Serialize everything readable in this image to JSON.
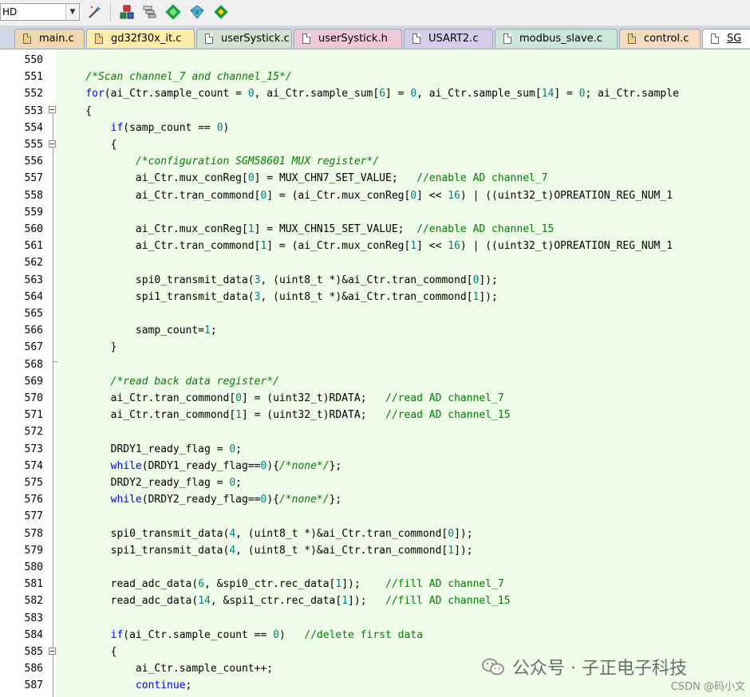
{
  "toolbar": {
    "target_value": "HD",
    "buttons": [
      "magic-wand-icon",
      "manage-components-icon",
      "pack-installer-icon",
      "select-packs-icon",
      "vcs-icon",
      "run-icon"
    ]
  },
  "tabs": [
    {
      "label": "main.c",
      "color": "#f2d8b0",
      "icon": "#f6d07a"
    },
    {
      "label": "gd32f30x_it.c",
      "color": "#ffeeaa",
      "icon": "#f6d07a"
    },
    {
      "label": "userSystick.c",
      "color": "#d6e2d0",
      "icon": "#ffffff"
    },
    {
      "label": "userSystick.h",
      "color": "#f0c8d8",
      "icon": "#ffffff"
    },
    {
      "label": "USART2.c",
      "color": "#d8ccec",
      "icon": "#ffffff"
    },
    {
      "label": "modbus_slave.c",
      "color": "#cde8d6",
      "icon": "#ffffff"
    },
    {
      "label": "control.c",
      "color": "#f6dcc0",
      "icon": "#f6d07a"
    },
    {
      "label": "SG",
      "color": "#ffffff",
      "icon": "#ffffff",
      "active": true
    }
  ],
  "code_lines": [
    {
      "n": "550",
      "segs": []
    },
    {
      "n": "551",
      "segs": [
        [
          "    ",
          ""
        ],
        [
          "/*Scan channel_7 and channel_15*/",
          "cm"
        ]
      ]
    },
    {
      "n": "552",
      "segs": [
        [
          "    ",
          ""
        ],
        [
          "for",
          "kw"
        ],
        [
          "(ai_Ctr.sample_count = ",
          ""
        ],
        [
          "0",
          "num"
        ],
        [
          ", ai_Ctr.sample_sum[",
          ""
        ],
        [
          "6",
          "num"
        ],
        [
          "] = ",
          ""
        ],
        [
          "0",
          "num"
        ],
        [
          ", ai_Ctr.sample_sum[",
          ""
        ],
        [
          "14",
          "num"
        ],
        [
          "] = ",
          ""
        ],
        [
          "0",
          "num"
        ],
        [
          "; ai_Ctr.sample",
          ""
        ]
      ]
    },
    {
      "n": "553",
      "segs": [
        [
          "    {",
          ""
        ]
      ]
    },
    {
      "n": "554",
      "segs": [
        [
          "        ",
          ""
        ],
        [
          "if",
          "kw"
        ],
        [
          "(samp_count == ",
          ""
        ],
        [
          "0",
          "num"
        ],
        [
          ")",
          ""
        ]
      ]
    },
    {
      "n": "555",
      "segs": [
        [
          "        {",
          ""
        ]
      ]
    },
    {
      "n": "556",
      "segs": [
        [
          "            ",
          ""
        ],
        [
          "/*configuration SGM58601 MUX register*/",
          "cm"
        ]
      ]
    },
    {
      "n": "557",
      "segs": [
        [
          "            ai_Ctr.mux_conReg[",
          ""
        ],
        [
          "0",
          "num"
        ],
        [
          "] = MUX_CHN7_SET_VALUE;   ",
          ""
        ],
        [
          "//enable AD channel_7",
          "cm2"
        ]
      ]
    },
    {
      "n": "558",
      "segs": [
        [
          "            ai_Ctr.tran_commond[",
          ""
        ],
        [
          "0",
          "num"
        ],
        [
          "] = (ai_Ctr.mux_conReg[",
          ""
        ],
        [
          "0",
          "num"
        ],
        [
          "] << ",
          ""
        ],
        [
          "16",
          "num"
        ],
        [
          ") | ((uint32_t)OPREATION_REG_NUM_1",
          ""
        ]
      ]
    },
    {
      "n": "559",
      "segs": []
    },
    {
      "n": "560",
      "segs": [
        [
          "            ai_Ctr.mux_conReg[",
          ""
        ],
        [
          "1",
          "num"
        ],
        [
          "] = MUX_CHN15_SET_VALUE;  ",
          ""
        ],
        [
          "//enable AD channel_15",
          "cm2"
        ]
      ]
    },
    {
      "n": "561",
      "segs": [
        [
          "            ai_Ctr.tran_commond[",
          ""
        ],
        [
          "1",
          "num"
        ],
        [
          "] = (ai_Ctr.mux_conReg[",
          ""
        ],
        [
          "1",
          "num"
        ],
        [
          "] << ",
          ""
        ],
        [
          "16",
          "num"
        ],
        [
          ") | ((uint32_t)OPREATION_REG_NUM_1",
          ""
        ]
      ]
    },
    {
      "n": "562",
      "segs": []
    },
    {
      "n": "563",
      "segs": [
        [
          "            spi0_transmit_data(",
          ""
        ],
        [
          "3",
          "num"
        ],
        [
          ", (uint8_t *)&ai_Ctr.tran_commond[",
          ""
        ],
        [
          "0",
          "num"
        ],
        [
          "]);",
          ""
        ]
      ]
    },
    {
      "n": "564",
      "segs": [
        [
          "            spi1_transmit_data(",
          ""
        ],
        [
          "3",
          "num"
        ],
        [
          ", (uint8_t *)&ai_Ctr.tran_commond[",
          ""
        ],
        [
          "1",
          "num"
        ],
        [
          "]);",
          ""
        ]
      ]
    },
    {
      "n": "565",
      "segs": []
    },
    {
      "n": "566",
      "segs": [
        [
          "            samp_count=",
          ""
        ],
        [
          "1",
          "num"
        ],
        [
          ";",
          ""
        ]
      ]
    },
    {
      "n": "567",
      "segs": [
        [
          "        }",
          ""
        ]
      ]
    },
    {
      "n": "568",
      "segs": []
    },
    {
      "n": "569",
      "segs": [
        [
          "        ",
          ""
        ],
        [
          "/*read back data register*/",
          "cm"
        ]
      ]
    },
    {
      "n": "570",
      "segs": [
        [
          "        ai_Ctr.tran_commond[",
          ""
        ],
        [
          "0",
          "num"
        ],
        [
          "] = (uint32_t)RDATA;   ",
          ""
        ],
        [
          "//read AD channel_7",
          "cm2"
        ]
      ]
    },
    {
      "n": "571",
      "segs": [
        [
          "        ai_Ctr.tran_commond[",
          ""
        ],
        [
          "1",
          "num"
        ],
        [
          "] = (uint32_t)RDATA;   ",
          ""
        ],
        [
          "//read AD channel_15",
          "cm2"
        ]
      ]
    },
    {
      "n": "572",
      "segs": []
    },
    {
      "n": "573",
      "segs": [
        [
          "        DRDY1_ready_flag = ",
          ""
        ],
        [
          "0",
          "num"
        ],
        [
          ";",
          ""
        ]
      ]
    },
    {
      "n": "574",
      "segs": [
        [
          "        ",
          ""
        ],
        [
          "while",
          "kw"
        ],
        [
          "(DRDY1_ready_flag==",
          ""
        ],
        [
          "0",
          "num"
        ],
        [
          "){",
          ""
        ],
        [
          "/*none*/",
          "cm"
        ],
        [
          "};",
          ""
        ]
      ]
    },
    {
      "n": "575",
      "segs": [
        [
          "        DRDY2_ready_flag = ",
          ""
        ],
        [
          "0",
          "num"
        ],
        [
          ";",
          ""
        ]
      ]
    },
    {
      "n": "576",
      "segs": [
        [
          "        ",
          ""
        ],
        [
          "while",
          "kw"
        ],
        [
          "(DRDY2_ready_flag==",
          ""
        ],
        [
          "0",
          "num"
        ],
        [
          "){",
          ""
        ],
        [
          "/*none*/",
          "cm"
        ],
        [
          "};",
          ""
        ]
      ]
    },
    {
      "n": "577",
      "segs": []
    },
    {
      "n": "578",
      "segs": [
        [
          "        spi0_transmit_data(",
          ""
        ],
        [
          "4",
          "num"
        ],
        [
          ", (uint8_t *)&ai_Ctr.tran_commond[",
          ""
        ],
        [
          "0",
          "num"
        ],
        [
          "]);",
          ""
        ]
      ]
    },
    {
      "n": "579",
      "segs": [
        [
          "        spi1_transmit_data(",
          ""
        ],
        [
          "4",
          "num"
        ],
        [
          ", (uint8_t *)&ai_Ctr.tran_commond[",
          ""
        ],
        [
          "1",
          "num"
        ],
        [
          "]);",
          ""
        ]
      ]
    },
    {
      "n": "580",
      "segs": []
    },
    {
      "n": "581",
      "segs": [
        [
          "        read_adc_data(",
          ""
        ],
        [
          "6",
          "num"
        ],
        [
          ", &spi0_ctr.rec_data[",
          ""
        ],
        [
          "1",
          "num"
        ],
        [
          "]);    ",
          ""
        ],
        [
          "//fill AD channel_7",
          "cm2"
        ]
      ]
    },
    {
      "n": "582",
      "segs": [
        [
          "        read_adc_data(",
          ""
        ],
        [
          "14",
          "num"
        ],
        [
          ", &spi1_ctr.rec_data[",
          ""
        ],
        [
          "1",
          "num"
        ],
        [
          "]);   ",
          ""
        ],
        [
          "//fill AD channel_15",
          "cm2"
        ]
      ]
    },
    {
      "n": "583",
      "segs": []
    },
    {
      "n": "584",
      "segs": [
        [
          "        ",
          ""
        ],
        [
          "if",
          "kw"
        ],
        [
          "(ai_Ctr.sample_count == ",
          ""
        ],
        [
          "0",
          "num"
        ],
        [
          ")   ",
          ""
        ],
        [
          "//delete first data",
          "cm2"
        ]
      ]
    },
    {
      "n": "585",
      "segs": [
        [
          "        {",
          ""
        ]
      ]
    },
    {
      "n": "586",
      "segs": [
        [
          "            ai_Ctr.sample_count++;",
          ""
        ]
      ]
    },
    {
      "n": "587",
      "segs": [
        [
          "            ",
          ""
        ],
        [
          "continue",
          "kw"
        ],
        [
          ";",
          ""
        ]
      ]
    }
  ],
  "fold_boxes": [
    "553",
    "555",
    "585"
  ],
  "fold_ends": [
    "568"
  ],
  "watermark": {
    "text": "公众号 · 子正电子科技",
    "csdn": "CSDN @码小文"
  }
}
